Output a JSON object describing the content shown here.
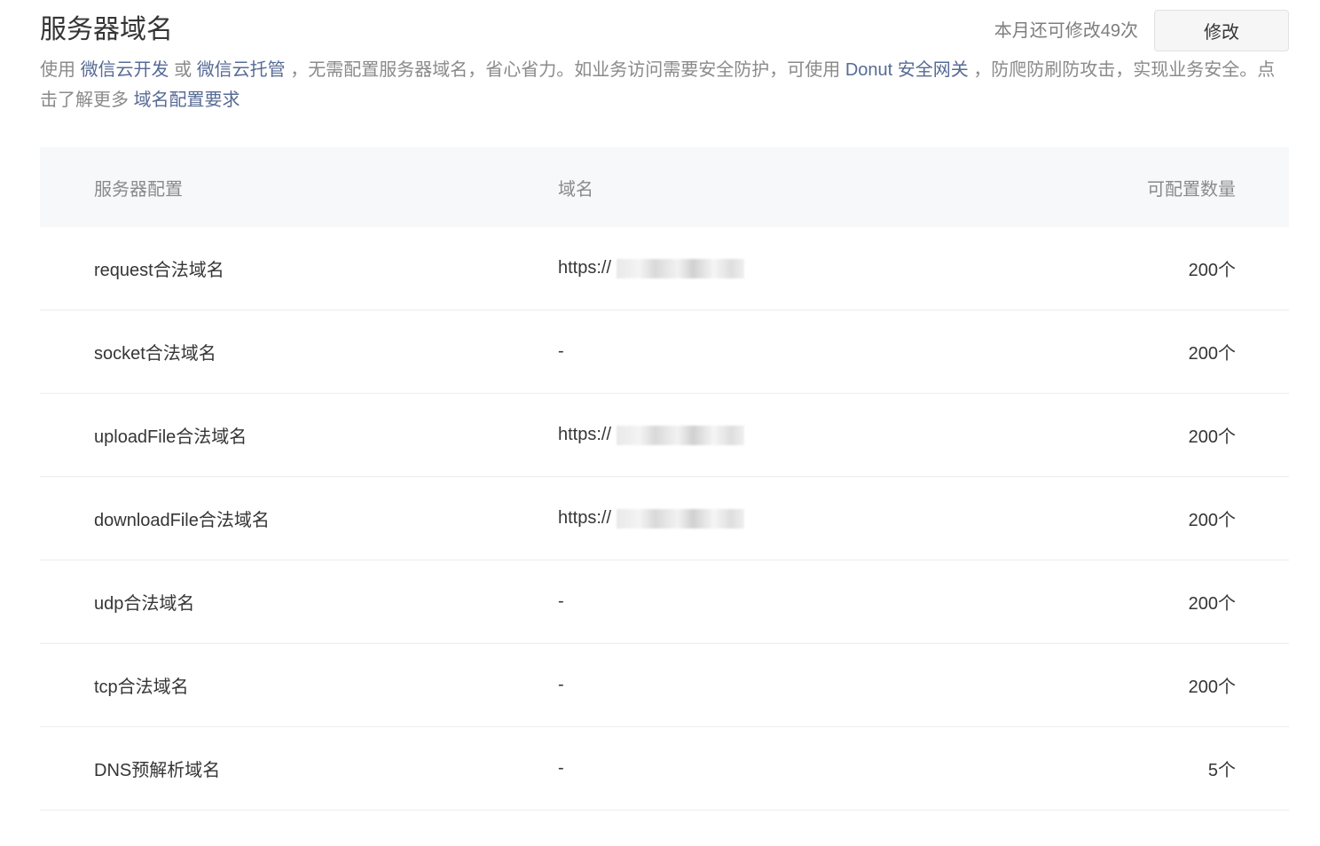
{
  "header": {
    "title": "服务器域名",
    "quota_text": "本月还可修改49次",
    "edit_label": "修改"
  },
  "description": {
    "p1": "使用",
    "link1": "微信云开发",
    "p2": "或",
    "link2": "微信云托管",
    "p3": "，无需配置服务器域名，省心省力。如业务访问需要安全防护，可使用",
    "link3": "Donut 安全网关",
    "p4": "，防爬防刷防攻击，实现业务安全。点击了解更多",
    "link4": "域名配置要求"
  },
  "table": {
    "headers": {
      "config": "服务器配置",
      "domain": "域名",
      "count": "可配置数量"
    },
    "rows": [
      {
        "config": "request合法域名",
        "domain": "https://",
        "count": "200个",
        "masked": true
      },
      {
        "config": "socket合法域名",
        "domain": "-",
        "count": "200个",
        "masked": false
      },
      {
        "config": "uploadFile合法域名",
        "domain": "https://",
        "count": "200个",
        "masked": true
      },
      {
        "config": "downloadFile合法域名",
        "domain": "https://",
        "count": "200个",
        "masked": true
      },
      {
        "config": "udp合法域名",
        "domain": "-",
        "count": "200个",
        "masked": false
      },
      {
        "config": "tcp合法域名",
        "domain": "-",
        "count": "200个",
        "masked": false
      },
      {
        "config": "DNS预解析域名",
        "domain": "-",
        "count": "5个",
        "masked": false
      }
    ]
  },
  "colors": {
    "link": "#576b95",
    "muted": "#8a8a8a",
    "header_bg": "#f7f8fa"
  }
}
